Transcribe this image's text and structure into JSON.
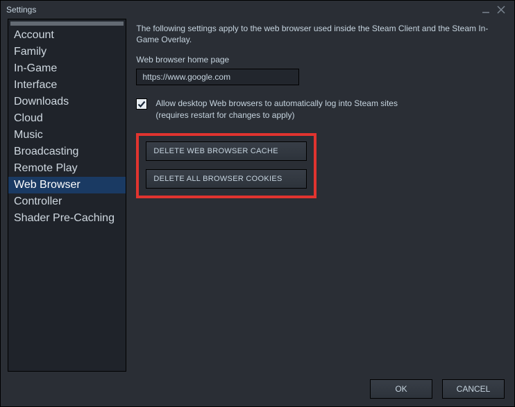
{
  "window": {
    "title": "Settings"
  },
  "sidebar": {
    "items": [
      {
        "label": "Account"
      },
      {
        "label": "Family"
      },
      {
        "label": "In-Game"
      },
      {
        "label": "Interface"
      },
      {
        "label": "Downloads"
      },
      {
        "label": "Cloud"
      },
      {
        "label": "Music"
      },
      {
        "label": "Broadcasting"
      },
      {
        "label": "Remote Play"
      },
      {
        "label": "Web Browser"
      },
      {
        "label": "Controller"
      },
      {
        "label": "Shader Pre-Caching"
      }
    ],
    "selected_index": 9
  },
  "content": {
    "description": "The following settings apply to the web browser used inside the Steam Client and the Steam In-Game Overlay.",
    "home_page_label": "Web browser home page",
    "home_page_value": "https://www.google.com",
    "auto_login_checked": true,
    "auto_login_text_line1": "Allow desktop Web browsers to automatically log into Steam sites",
    "auto_login_text_line2": "(requires restart for changes to apply)",
    "delete_cache_label": "DELETE WEB BROWSER CACHE",
    "delete_cookies_label": "DELETE ALL BROWSER COOKIES"
  },
  "footer": {
    "ok_label": "OK",
    "cancel_label": "CANCEL"
  }
}
